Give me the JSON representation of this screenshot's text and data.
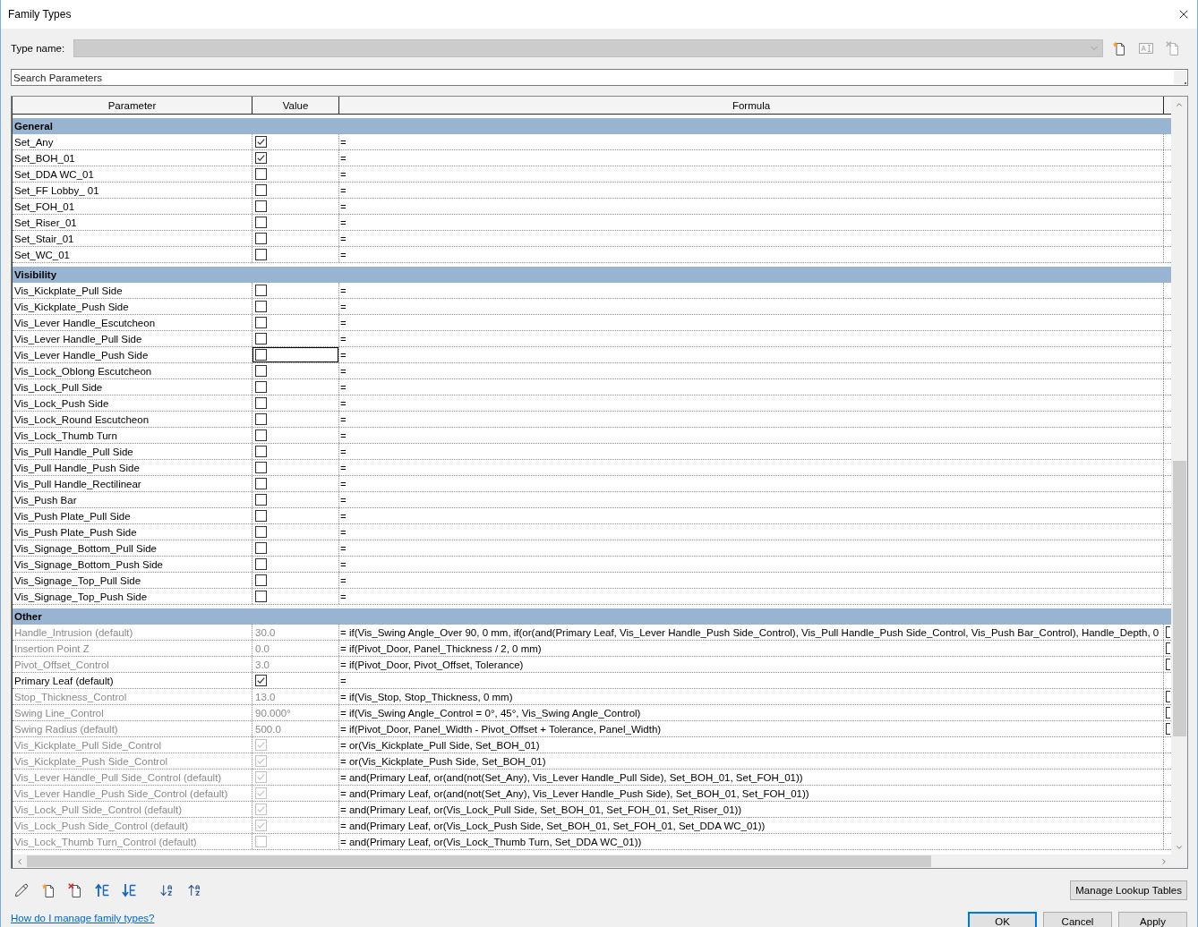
{
  "window": {
    "title": "Family Types"
  },
  "type_name": {
    "label": "Type name:",
    "disabled": true
  },
  "search": {
    "placeholder": "Search Parameters"
  },
  "table": {
    "columns": [
      "Parameter",
      "Value",
      "Formula"
    ],
    "groups": [
      {
        "name": "General",
        "rows": [
          {
            "parameter": "Set_Any",
            "kind": "checkbox",
            "checked": true,
            "formula": "=",
            "disabled": false,
            "selected": false
          },
          {
            "parameter": "Set_BOH_01",
            "kind": "checkbox",
            "checked": true,
            "formula": "=",
            "disabled": false,
            "selected": false
          },
          {
            "parameter": "Set_DDA WC_01",
            "kind": "checkbox",
            "checked": false,
            "formula": "=",
            "disabled": false,
            "selected": false
          },
          {
            "parameter": "Set_FF Lobby_ 01",
            "kind": "checkbox",
            "checked": false,
            "formula": "=",
            "disabled": false,
            "selected": false
          },
          {
            "parameter": "Set_FOH_01",
            "kind": "checkbox",
            "checked": false,
            "formula": "=",
            "disabled": false,
            "selected": false
          },
          {
            "parameter": "Set_Riser_01",
            "kind": "checkbox",
            "checked": false,
            "formula": "=",
            "disabled": false,
            "selected": false
          },
          {
            "parameter": "Set_Stair_01",
            "kind": "checkbox",
            "checked": false,
            "formula": "=",
            "disabled": false,
            "selected": false
          },
          {
            "parameter": "Set_WC_01",
            "kind": "checkbox",
            "checked": false,
            "formula": "=",
            "disabled": false,
            "selected": false
          }
        ]
      },
      {
        "name": "Visibility",
        "rows": [
          {
            "parameter": "Vis_Kickplate_Pull Side",
            "kind": "checkbox",
            "checked": false,
            "formula": "=",
            "disabled": false,
            "selected": false
          },
          {
            "parameter": "Vis_Kickplate_Push Side",
            "kind": "checkbox",
            "checked": false,
            "formula": "=",
            "disabled": false,
            "selected": false
          },
          {
            "parameter": "Vis_Lever Handle_Escutcheon",
            "kind": "checkbox",
            "checked": false,
            "formula": "=",
            "disabled": false,
            "selected": false
          },
          {
            "parameter": "Vis_Lever Handle_Pull Side",
            "kind": "checkbox",
            "checked": false,
            "formula": "=",
            "disabled": false,
            "selected": false
          },
          {
            "parameter": "Vis_Lever Handle_Push Side",
            "kind": "checkbox",
            "checked": false,
            "formula": "=",
            "disabled": false,
            "selected": true
          },
          {
            "parameter": "Vis_Lock_Oblong Escutcheon",
            "kind": "checkbox",
            "checked": false,
            "formula": "=",
            "disabled": false,
            "selected": false
          },
          {
            "parameter": "Vis_Lock_Pull Side",
            "kind": "checkbox",
            "checked": false,
            "formula": "=",
            "disabled": false,
            "selected": false
          },
          {
            "parameter": "Vis_Lock_Push Side",
            "kind": "checkbox",
            "checked": false,
            "formula": "=",
            "disabled": false,
            "selected": false
          },
          {
            "parameter": "Vis_Lock_Round Escutcheon",
            "kind": "checkbox",
            "checked": false,
            "formula": "=",
            "disabled": false,
            "selected": false
          },
          {
            "parameter": "Vis_Lock_Thumb Turn",
            "kind": "checkbox",
            "checked": false,
            "formula": "=",
            "disabled": false,
            "selected": false
          },
          {
            "parameter": "Vis_Pull Handle_Pull Side",
            "kind": "checkbox",
            "checked": false,
            "formula": "=",
            "disabled": false,
            "selected": false
          },
          {
            "parameter": "Vis_Pull Handle_Push Side",
            "kind": "checkbox",
            "checked": false,
            "formula": "=",
            "disabled": false,
            "selected": false
          },
          {
            "parameter": "Vis_Pull Handle_Rectilinear",
            "kind": "checkbox",
            "checked": false,
            "formula": "=",
            "disabled": false,
            "selected": false
          },
          {
            "parameter": "Vis_Push Bar",
            "kind": "checkbox",
            "checked": false,
            "formula": "=",
            "disabled": false,
            "selected": false
          },
          {
            "parameter": "Vis_Push Plate_Pull Side",
            "kind": "checkbox",
            "checked": false,
            "formula": "=",
            "disabled": false,
            "selected": false
          },
          {
            "parameter": "Vis_Push Plate_Push Side",
            "kind": "checkbox",
            "checked": false,
            "formula": "=",
            "disabled": false,
            "selected": false
          },
          {
            "parameter": "Vis_Signage_Bottom_Pull Side",
            "kind": "checkbox",
            "checked": false,
            "formula": "=",
            "disabled": false,
            "selected": false
          },
          {
            "parameter": "Vis_Signage_Bottom_Push Side",
            "kind": "checkbox",
            "checked": false,
            "formula": "=",
            "disabled": false,
            "selected": false
          },
          {
            "parameter": "Vis_Signage_Top_Pull Side",
            "kind": "checkbox",
            "checked": false,
            "formula": "=",
            "disabled": false,
            "selected": false
          },
          {
            "parameter": "Vis_Signage_Top_Push Side",
            "kind": "checkbox",
            "checked": false,
            "formula": "=",
            "disabled": false,
            "selected": false
          }
        ]
      },
      {
        "name": "Other",
        "rows": [
          {
            "parameter": "Handle_Intrusion (default)",
            "kind": "text",
            "value": "30.0",
            "formula": "= if(Vis_Swing Angle_Over 90, 0 mm, if(or(and(Primary Leaf, Vis_Lever Handle_Push Side_Control), Vis_Pull Handle_Push Side_Control, Vis_Push Bar_Control), Handle_Depth, 0",
            "disabled": true,
            "selected": false,
            "column_4_checkbox": true
          },
          {
            "parameter": "Insertion Point Z",
            "kind": "text",
            "value": "0.0",
            "formula": "= if(Pivot_Door, Panel_Thickness / 2, 0 mm)",
            "disabled": true,
            "selected": false,
            "column_4_checkbox": true
          },
          {
            "parameter": "Pivot_Offset_Control",
            "kind": "text",
            "value": "3.0",
            "formula": "= if(Pivot_Door, Pivot_Offset, Tolerance)",
            "disabled": true,
            "selected": false,
            "column_4_checkbox": true
          },
          {
            "parameter": "Primary Leaf (default)",
            "kind": "checkbox",
            "checked": true,
            "formula": "=",
            "disabled": false,
            "selected": false,
            "column_4_checkbox": false
          },
          {
            "parameter": "Stop_Thickness_Control",
            "kind": "text",
            "value": "13.0",
            "formula": "= if(Vis_Stop, Stop_Thickness, 0 mm)",
            "disabled": true,
            "selected": false,
            "column_4_checkbox": true
          },
          {
            "parameter": "Swing Line_Control",
            "kind": "text",
            "value": "90.000°",
            "formula": "= if(Vis_Swing Angle_Control = 0°, 45°, Vis_Swing Angle_Control)",
            "disabled": true,
            "selected": false,
            "column_4_checkbox": true
          },
          {
            "parameter": "Swing Radius (default)",
            "kind": "text",
            "value": "500.0",
            "formula": "= if(Pivot_Door, Panel_Width - Pivot_Offset + Tolerance, Panel_Width)",
            "disabled": true,
            "selected": false,
            "column_4_checkbox": true
          },
          {
            "parameter": "Vis_Kickplate_Pull Side_Control",
            "kind": "checkbox",
            "checked": true,
            "formula": "= or(Vis_Kickplate_Pull Side, Set_BOH_01)",
            "disabled": true,
            "selected": false,
            "column_4_checkbox": false
          },
          {
            "parameter": "Vis_Kickplate_Push Side_Control",
            "kind": "checkbox",
            "checked": true,
            "formula": "= or(Vis_Kickplate_Push Side, Set_BOH_01)",
            "disabled": true,
            "selected": false,
            "column_4_checkbox": false
          },
          {
            "parameter": "Vis_Lever Handle_Pull Side_Control (default)",
            "kind": "checkbox",
            "checked": true,
            "formula": "= and(Primary Leaf, or(and(not(Set_Any), Vis_Lever Handle_Pull Side), Set_BOH_01, Set_FOH_01))",
            "disabled": true,
            "selected": false,
            "column_4_checkbox": false
          },
          {
            "parameter": "Vis_Lever Handle_Push Side_Control (default)",
            "kind": "checkbox",
            "checked": true,
            "formula": "= and(Primary Leaf, or(and(not(Set_Any), Vis_Lever Handle_Push Side), Set_BOH_01, Set_FOH_01))",
            "disabled": true,
            "selected": false,
            "column_4_checkbox": false
          },
          {
            "parameter": "Vis_Lock_Pull Side_Control (default)",
            "kind": "checkbox",
            "checked": true,
            "formula": "= and(Primary Leaf, or(Vis_Lock_Pull Side, Set_BOH_01, Set_FOH_01, Set_Riser_01))",
            "disabled": true,
            "selected": false,
            "column_4_checkbox": false
          },
          {
            "parameter": "Vis_Lock_Push Side_Control (default)",
            "kind": "checkbox",
            "checked": true,
            "formula": "= and(Primary Leaf, or(Vis_Lock_Push Side, Set_BOH_01, Set_FOH_01, Set_DDA WC_01))",
            "disabled": true,
            "selected": false,
            "column_4_checkbox": false
          },
          {
            "parameter": "Vis_Lock_Thumb Turn_Control (default)",
            "kind": "checkbox",
            "checked": false,
            "formula": "= and(Primary Leaf, or(Vis_Lock_Thumb Turn, Set_DDA WC_01))",
            "disabled": true,
            "selected": false,
            "column_4_checkbox": false
          }
        ]
      }
    ]
  },
  "lookup_button": {
    "label": "Manage Lookup Tables"
  },
  "help_link": {
    "label": "How do I manage family types?"
  },
  "dialog_buttons": [
    {
      "label": "OK",
      "default": true
    },
    {
      "label": "Cancel",
      "default": false
    },
    {
      "label": "Apply",
      "default": false
    }
  ]
}
